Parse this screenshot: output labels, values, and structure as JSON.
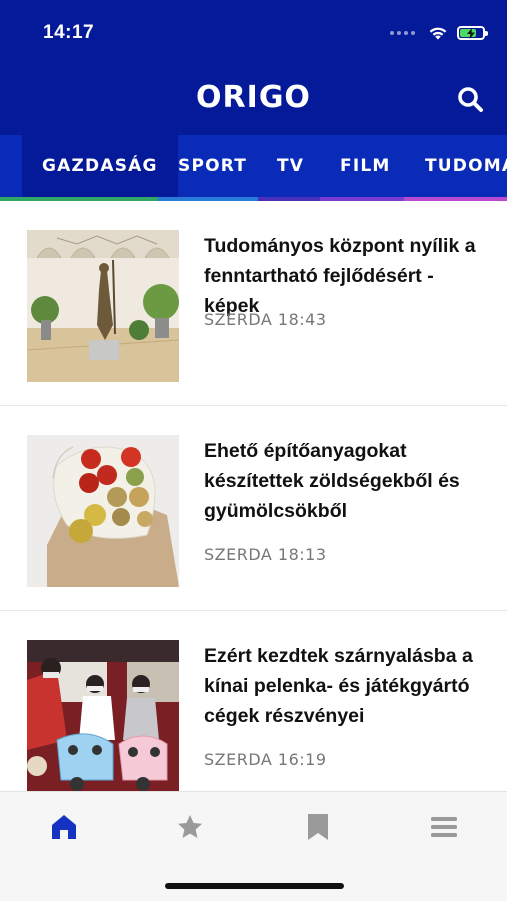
{
  "status_bar": {
    "time": "14:17"
  },
  "header": {
    "logo": "ORIGO"
  },
  "tabs": [
    {
      "label": "GAZDASÁG",
      "active": true,
      "underline_color": "#2fa866"
    },
    {
      "label": "SPORT",
      "active": false,
      "underline_color": "#2a7ad8"
    },
    {
      "label": "TV",
      "active": false,
      "underline_color": "#4a2fb8"
    },
    {
      "label": "FILM",
      "active": false,
      "underline_color": "#7b3bd0"
    },
    {
      "label": "TUDOMÁNY",
      "active": false,
      "underline_color": "#b84ad0"
    }
  ],
  "articles": [
    {
      "title": "Tudományos központ nyílik a fenntartható fejlődésért - képek",
      "time": "SZERDA 18:43",
      "image": "statue-courtyard"
    },
    {
      "title": "Ehető építőanyagokat készítettek zöldségekből és gyümölcsökből",
      "time": "SZERDA 18:13",
      "image": "vegetables-bag"
    },
    {
      "title": "Ezért kezdtek szárnyalásba a kínai pelenka- és játékgyártó cégek részvényei",
      "time": "SZERDA 16:19",
      "image": "toy-scooters"
    }
  ],
  "bottom_nav": [
    {
      "icon": "home-icon",
      "active": true
    },
    {
      "icon": "star-icon",
      "active": false
    },
    {
      "icon": "bookmark-icon",
      "active": false
    },
    {
      "icon": "menu-icon",
      "active": false
    }
  ],
  "colors": {
    "header_bg": "#051a99",
    "tabs_bg": "#0a2ab8",
    "active_nav": "#1533c0",
    "inactive_nav": "#9a9a9a"
  }
}
